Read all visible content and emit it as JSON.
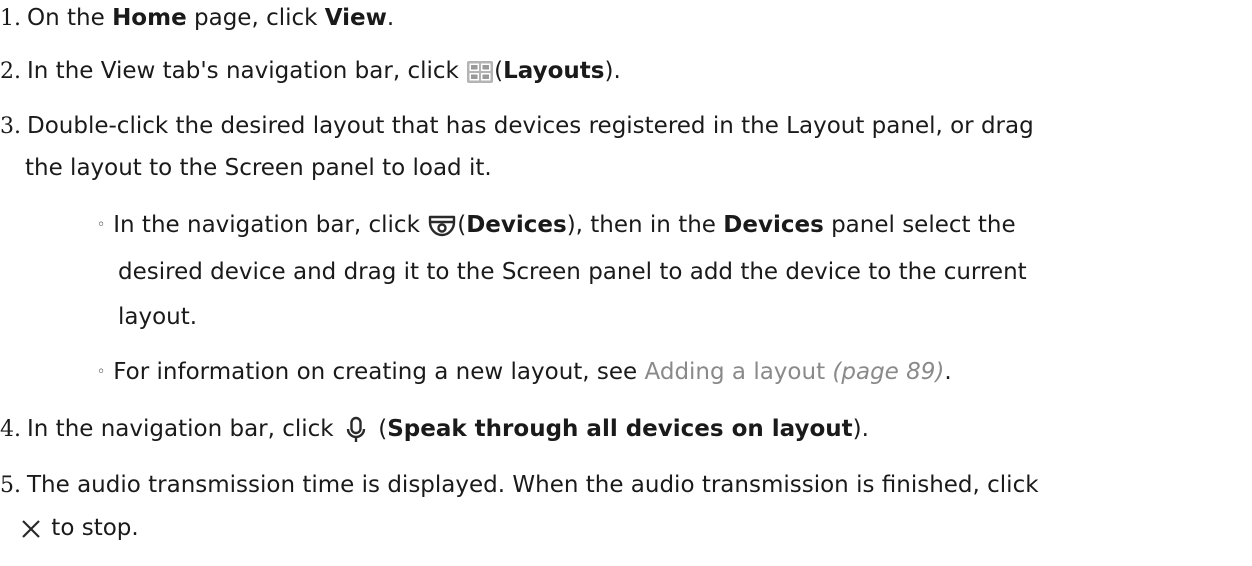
{
  "steps": [
    {
      "number": "1.",
      "pre": "On the ",
      "home": "Home",
      "mid": " page, click ",
      "view": "View",
      "post": "."
    },
    {
      "number": "2.",
      "pre": "In the View tab's navigation bar, click ",
      "icon": "layouts-grid-icon",
      "open_paren": "(",
      "label": "Layouts",
      "post": ")."
    },
    {
      "number": "3.",
      "line1": "Double-click the desired layout that has devices registered in the Layout panel, or drag",
      "line2": "the layout to the Screen panel to load it.",
      "subitems": [
        {
          "bullet": "◦",
          "pre": "In the navigation bar, click ",
          "icon": "camera-dome-icon",
          "open_paren": "(",
          "label": "Devices",
          "mid": "), then in the ",
          "label2": "Devices",
          "post": " panel select the",
          "line2": "desired device and drag it to the Screen panel to add the device to the current",
          "line3": "layout."
        },
        {
          "bullet": "◦",
          "pre": "For information on creating a new layout, see ",
          "link_text": "Adding a layout",
          "page_ref": " (page 89)",
          "post": "."
        }
      ]
    },
    {
      "number": "4.",
      "pre": "In the navigation bar, click ",
      "icon": "microphone-icon",
      "open_paren": " (",
      "label": "Speak through all devices on layout",
      "post": ")."
    },
    {
      "number": "5.",
      "line1": "The audio transmission time is displayed. When the audio transmission is finished, click",
      "icon": "close-x-icon",
      "line2": " to stop."
    }
  ]
}
